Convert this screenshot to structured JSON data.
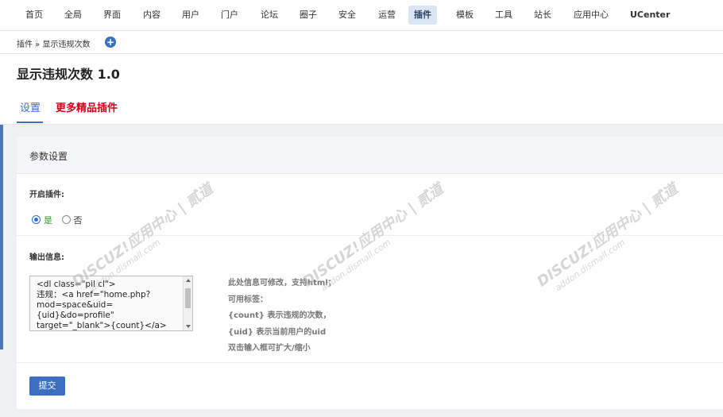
{
  "nav": {
    "items": [
      {
        "label": "首页"
      },
      {
        "label": "全局"
      },
      {
        "label": "界面"
      },
      {
        "label": "内容"
      },
      {
        "label": "用户"
      },
      {
        "label": "门户"
      },
      {
        "label": "论坛"
      },
      {
        "label": "圈子"
      },
      {
        "label": "安全"
      },
      {
        "label": "运营"
      },
      {
        "label": "插件",
        "active": true
      },
      {
        "label": "模板"
      },
      {
        "label": "工具"
      },
      {
        "label": "站长"
      },
      {
        "label": "应用中心"
      },
      {
        "label": "UCenter"
      }
    ]
  },
  "breadcrumb": {
    "text": "插件 » 显示违规次数",
    "add_icon": "plus-circle-icon"
  },
  "page": {
    "title": "显示违规次数 1.0"
  },
  "tabs": [
    {
      "label": "设置",
      "active": true
    },
    {
      "label": "更多精品插件",
      "color": "#d0021b"
    }
  ],
  "panel": {
    "title": "参数设置",
    "enable": {
      "label": "开启插件:",
      "options": [
        {
          "label": "是",
          "checked": true
        },
        {
          "label": "否",
          "checked": false
        }
      ]
    },
    "output": {
      "label": "输出信息:",
      "value": "<dl class=\"pil cl\">\n违规：<a href=\"home.php?mod=space&uid={uid}&do=profile\" target=\"_blank\">{count}</a>",
      "help": [
        "此处信息可修改，支持html；",
        "可用标签：",
        "{count} 表示违规的次数，",
        "{uid} 表示当前用户的uid",
        "双击输入框可扩大/缩小"
      ]
    },
    "submit_label": "提交"
  },
  "watermark": {
    "line1": "DISCUZ!应用中心 | 贰道",
    "line2": "addon.dismall.com"
  },
  "colors": {
    "accent": "#3a6fc1",
    "promo": "#d0021b",
    "yes": "#2a9b2a"
  }
}
